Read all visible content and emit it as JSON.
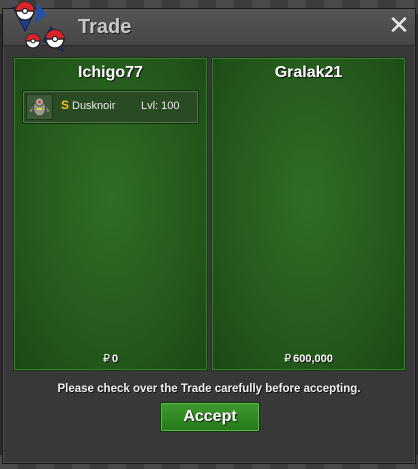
{
  "window": {
    "title": "Trade",
    "close_label": "✕"
  },
  "left_player": {
    "name": "Ichigo77",
    "offer_items": [
      {
        "shiny_mark": "S",
        "pokemon": "Dusknoir",
        "level_text": "Lvl: 100",
        "sprite": "dusknoir-sprite-icon"
      }
    ],
    "currency_symbol": "₽",
    "money": "0"
  },
  "right_player": {
    "name": "Gralak21",
    "offer_items": [],
    "currency_symbol": "₽",
    "money": "600,000"
  },
  "notice": "Please check over the Trade carefully before accepting.",
  "accept_label": "Accept",
  "colors": {
    "panel_green": "#255c1c",
    "accept_green": "#2e8a22",
    "shiny_gold": "#f2c21b",
    "title_gray": "#c8c8c8"
  }
}
